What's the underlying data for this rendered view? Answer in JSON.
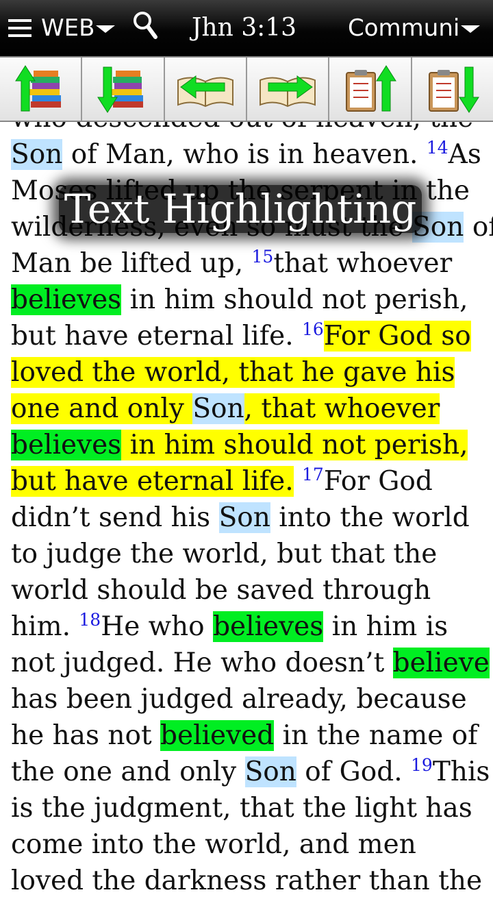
{
  "header": {
    "translation": "WEB",
    "reference": "Jhn 3:13",
    "commentary": "Communi"
  },
  "toolbar": {
    "buttons": [
      {
        "icon": "book-stack-up-icon"
      },
      {
        "icon": "book-stack-down-icon"
      },
      {
        "icon": "book-prev-icon"
      },
      {
        "icon": "book-next-icon"
      },
      {
        "icon": "clipboard-up-icon"
      },
      {
        "icon": "clipboard-down-icon"
      }
    ]
  },
  "overlay": {
    "text": "Text Highlighting"
  },
  "colors": {
    "verse_number": "#1a1adf",
    "highlight_yellow": "#ffff00",
    "highlight_green": "#00ee22",
    "highlight_blue": "#bfe3ff"
  },
  "passage": {
    "lines": [
      [
        {
          "t": "who descended out of heaven, the"
        }
      ],
      [
        {
          "t": "Son",
          "h": "blue"
        },
        {
          "t": " of Man, who is in heaven. "
        },
        {
          "v": "14"
        },
        {
          "t": "As"
        }
      ],
      [
        {
          "t": "Moses lifted up the serpent in the"
        }
      ],
      [
        {
          "t": "wilderness, even so must the "
        },
        {
          "t": "Son",
          "h": "blue"
        },
        {
          "t": " of"
        }
      ],
      [
        {
          "t": "Man be lifted up, "
        },
        {
          "v": "15"
        },
        {
          "t": "that whoever"
        }
      ],
      [
        {
          "t": "believes",
          "h": "green"
        },
        {
          "t": " in him should not perish,"
        }
      ],
      [
        {
          "t": "but have eternal life. "
        },
        {
          "v": "16"
        },
        {
          "t": "For God so",
          "h": "yellow"
        }
      ],
      [
        {
          "t": "loved the world, that he gave his",
          "h": "yellow"
        }
      ],
      [
        {
          "t": "one and only ",
          "h": "yellow"
        },
        {
          "t": "Son",
          "h": "blue"
        },
        {
          "t": ", that whoever",
          "h": "yellow"
        }
      ],
      [
        {
          "t": "believes",
          "h": "green"
        },
        {
          "t": " in him should not perish,",
          "h": "yellow"
        }
      ],
      [
        {
          "t": "but have eternal life.",
          "h": "yellow"
        },
        {
          "t": " "
        },
        {
          "v": "17"
        },
        {
          "t": "For God"
        }
      ],
      [
        {
          "t": "didn’t send his "
        },
        {
          "t": "Son",
          "h": "blue"
        },
        {
          "t": " into the world"
        }
      ],
      [
        {
          "t": "to judge the world, but that the"
        }
      ],
      [
        {
          "t": "world should be saved through"
        }
      ],
      [
        {
          "t": "him. "
        },
        {
          "v": "18"
        },
        {
          "t": "He who "
        },
        {
          "t": "believes",
          "h": "green"
        },
        {
          "t": " in him is"
        }
      ],
      [
        {
          "t": "not judged. He who doesn’t "
        },
        {
          "t": "believe",
          "h": "green"
        }
      ],
      [
        {
          "t": "has been judged already, because"
        }
      ],
      [
        {
          "t": "he has not "
        },
        {
          "t": "believed",
          "h": "green"
        },
        {
          "t": " in the name of"
        }
      ],
      [
        {
          "t": "the one and only "
        },
        {
          "t": "Son",
          "h": "blue"
        },
        {
          "t": " of God. "
        },
        {
          "v": "19"
        },
        {
          "t": "This"
        }
      ],
      [
        {
          "t": "is the judgment, that the light has"
        }
      ],
      [
        {
          "t": "come into the world, and men"
        }
      ],
      [
        {
          "t": "loved the darkness rather than the"
        }
      ]
    ]
  }
}
